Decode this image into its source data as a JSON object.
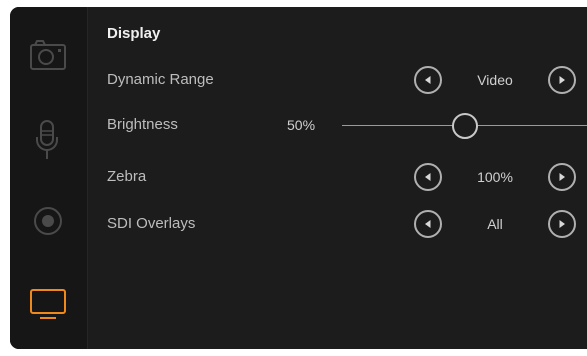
{
  "sidebar": {
    "items": [
      {
        "icon": "camera-icon",
        "active": false
      },
      {
        "icon": "microphone-icon",
        "active": false
      },
      {
        "icon": "record-icon",
        "active": false
      },
      {
        "icon": "monitor-icon",
        "active": true
      }
    ]
  },
  "display": {
    "title": "Display",
    "dynamic_range": {
      "label": "Dynamic Range",
      "value": "Video"
    },
    "brightness": {
      "label": "Brightness",
      "value_text": "50%",
      "value": 50
    },
    "zebra": {
      "label": "Zebra",
      "value": "100%"
    },
    "sdi_overlays": {
      "label": "SDI Overlays",
      "value": "All"
    }
  },
  "colors": {
    "accent": "#f0891c",
    "background": "#1c1c1c",
    "sidebar": "#161616",
    "inactive_icon": "#4a4a4a"
  }
}
